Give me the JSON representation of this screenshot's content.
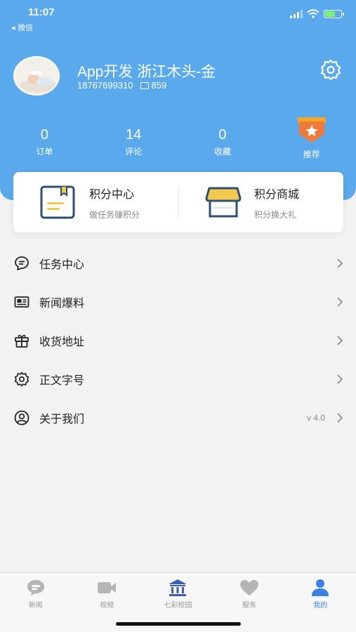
{
  "status_bar": {
    "time": "11:07",
    "back_label": "◂ 微信"
  },
  "profile": {
    "name": "App开发 浙江木头-金",
    "phone": "18767699310",
    "points": "859"
  },
  "stats": [
    {
      "value": "0",
      "label": "订单"
    },
    {
      "value": "14",
      "label": "评论"
    },
    {
      "value": "0",
      "label": "收藏"
    },
    {
      "value": "",
      "label": "推荐"
    }
  ],
  "cards": [
    {
      "title": "积分中心",
      "subtitle": "做任务赚积分"
    },
    {
      "title": "积分商城",
      "subtitle": "积分换大礼"
    }
  ],
  "menu": [
    {
      "label": "任务中心",
      "icon": "chat-bubble-icon",
      "extra": ""
    },
    {
      "label": "新闻爆料",
      "icon": "newspaper-icon",
      "extra": ""
    },
    {
      "label": "收货地址",
      "icon": "gift-box-icon",
      "extra": ""
    },
    {
      "label": "正文字号",
      "icon": "gear-icon",
      "extra": ""
    },
    {
      "label": "关于我们",
      "icon": "user-circle-icon",
      "extra": "v 4.0"
    }
  ],
  "tabs": [
    {
      "label": "新闻",
      "icon": "news-bubble-icon",
      "active": false
    },
    {
      "label": "视频",
      "icon": "video-camera-icon",
      "active": false
    },
    {
      "label": "七彩校园",
      "icon": "campus-building-icon",
      "active": false
    },
    {
      "label": "服务",
      "icon": "heart-icon",
      "active": false
    },
    {
      "label": "我的",
      "icon": "person-icon",
      "active": true
    }
  ],
  "colors": {
    "header_bg": "#5aa9ec",
    "active_tab": "#3b82e0",
    "inactive_tab": "#b5b5b5",
    "card_icon_dark": "#2d4f75",
    "card_icon_yellow": "#f2c94c",
    "medal_orange": "#f07a3a"
  }
}
